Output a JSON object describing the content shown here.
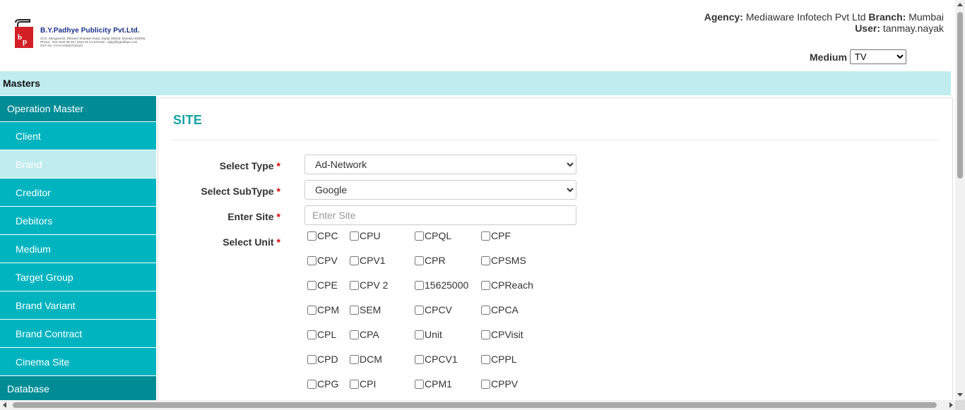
{
  "header": {
    "company_name": "B.Y.Padhye Publicity Pvt.Ltd.",
    "address_line1": "22 E, Shivganesh, Bhavani Shankar Road, Dadar (West), Mumbai 400028.",
    "address_line2": "Phone : 022 2422 08 48 / 2422 02 41 ● Email : vijay@bypadhye.com",
    "address_line3": "GST No. 27AAACB1871D1Z3",
    "agency_label": "Agency:",
    "agency_value": "Mediaware Infotech Pvt Ltd",
    "branch_label": "Branch:",
    "branch_value": "Mumbai",
    "user_label": "User:",
    "user_value": "tanmay.nayak",
    "medium_label": "Medium",
    "medium_selected": "TV"
  },
  "masters_bar": {
    "label": "Masters"
  },
  "sidebar": {
    "section_operation": "Operation Master",
    "items": [
      {
        "label": "Client"
      },
      {
        "label": "Brand"
      },
      {
        "label": "Creditor"
      },
      {
        "label": "Debitors"
      },
      {
        "label": "Medium"
      },
      {
        "label": "Target Group"
      },
      {
        "label": "Brand Variant"
      },
      {
        "label": "Brand Contract"
      },
      {
        "label": "Cinema Site"
      }
    ],
    "section_database": "Database"
  },
  "form": {
    "title": "SITE",
    "type_label": "Select Type",
    "type_value": "Ad-Network",
    "subtype_label": "Select SubType",
    "subtype_value": "Google",
    "site_label": "Enter Site",
    "site_placeholder": "Enter Site",
    "unit_label": "Select Unit",
    "required_mark": "*",
    "units": [
      "CPC",
      "CPU",
      "CPQL",
      "CPF",
      "CPV",
      "CPV1",
      "CPR",
      "CPSMS",
      "CPE",
      "CPV 2",
      "15625000",
      "CPReach",
      "CPM",
      "SEM",
      "CPCV",
      "CPCA",
      "CPL",
      "CPA",
      "Unit",
      "CPVisit",
      "CPD",
      "DCM",
      "CPCV1",
      "CPPL",
      "CPG",
      "CPI",
      "CPM1",
      "CPPV"
    ]
  },
  "colors": {
    "accent_dark": "#008c95",
    "accent": "#00b4bf",
    "accent_light": "#c0ecef",
    "title": "#17a3a3",
    "required": "#d00000"
  }
}
